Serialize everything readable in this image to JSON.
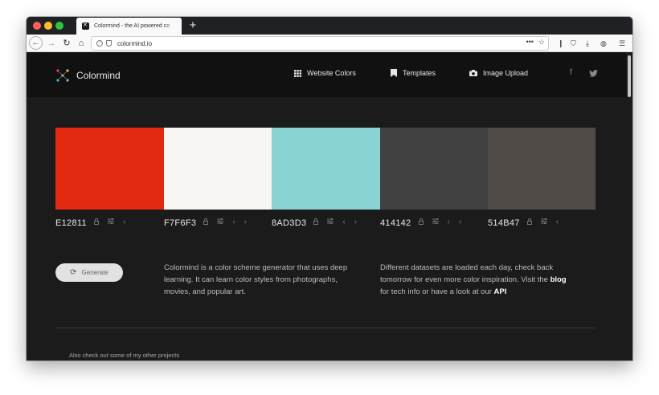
{
  "browser": {
    "tab_title": "Colormind - the AI powered co",
    "new_tab": "+",
    "url": "colormind.io",
    "url_actions": "•••"
  },
  "header": {
    "logo_text": "Colormind",
    "menu": [
      {
        "icon": "grid-icon",
        "label": "Website Colors"
      },
      {
        "icon": "bookmark-icon",
        "label": "Templates"
      },
      {
        "icon": "camera-icon",
        "label": "Image Upload"
      }
    ],
    "social": {
      "facebook": "f",
      "twitter": "twitter"
    }
  },
  "palette": [
    {
      "hex": "E12811",
      "color": "#E12811"
    },
    {
      "hex": "F7F6F3",
      "color": "#F7F6F3"
    },
    {
      "hex": "8AD3D3",
      "color": "#8AD3D3"
    },
    {
      "hex": "414142",
      "color": "#414142"
    },
    {
      "hex": "514B47",
      "color": "#514B47"
    }
  ],
  "generate_label": "Generate",
  "description_1": "Colormind is a color scheme generator that uses deep learning. It can learn color styles from photographs, movies, and popular art.",
  "description_2": {
    "part1": "Different datasets are loaded each day, check back tomorrow for even more color inspiration. Visit the ",
    "link1": "blog",
    "part2": " for tech info or have a look at our ",
    "link2": "API"
  },
  "footer_note": "Also check out some of my other projects"
}
